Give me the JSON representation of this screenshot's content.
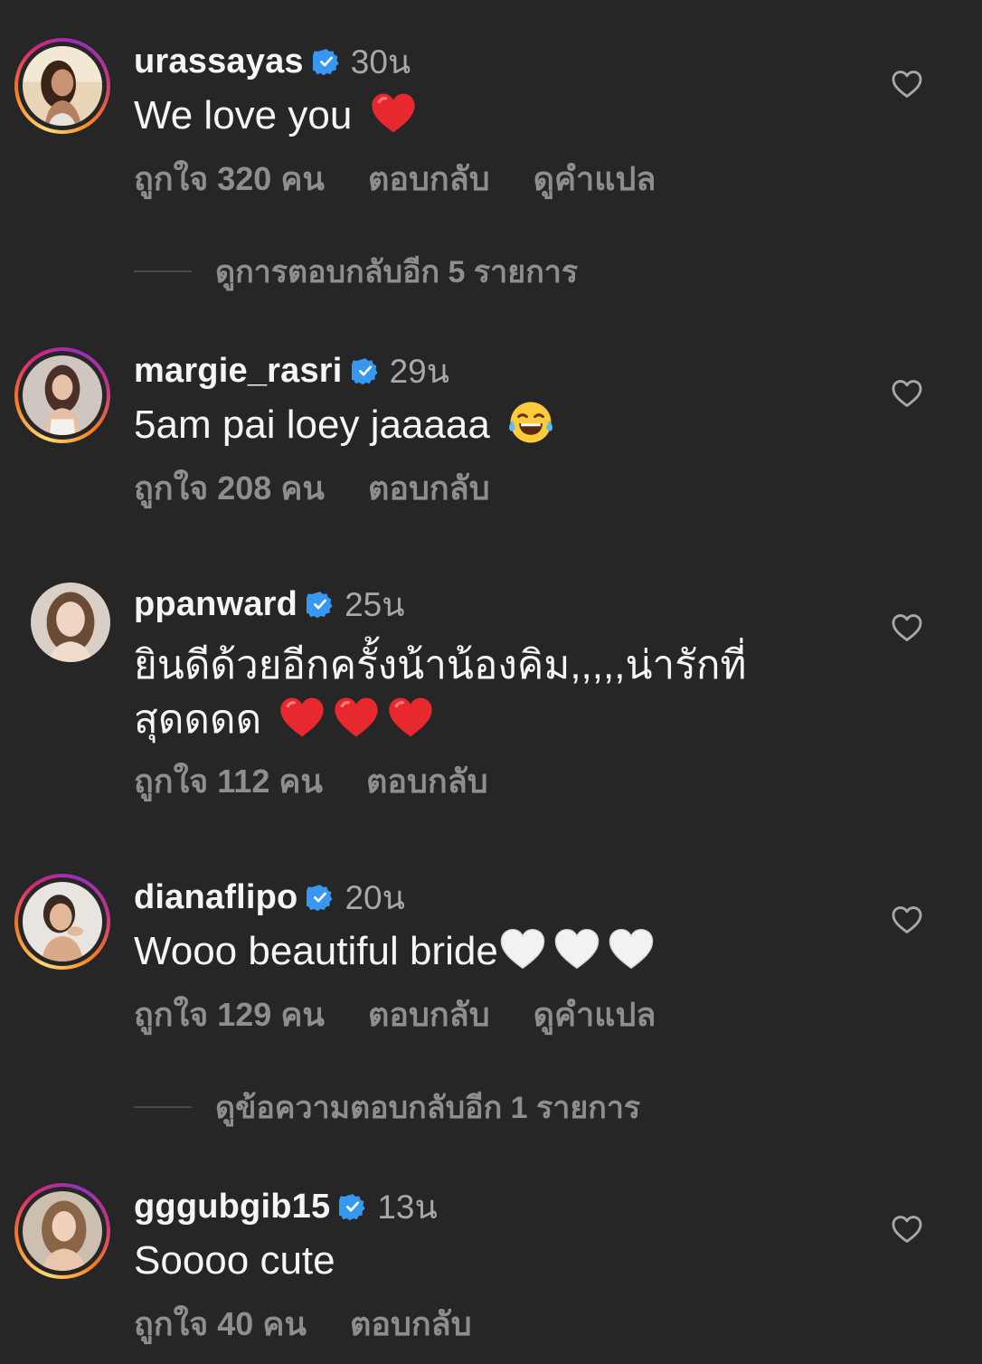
{
  "colors": {
    "background": "#262626",
    "primary_text": "#f5f5f5",
    "secondary_text": "#a8a8a8",
    "action_text": "#8e8e8e",
    "verified_badge": "#3897f0",
    "story_ring": [
      "#feda75",
      "#fa7e1e",
      "#d62976",
      "#962fbf"
    ]
  },
  "comments": [
    {
      "username": "urassayas",
      "verified": true,
      "time": "30น",
      "text": "We love you",
      "emojis": [
        "red-heart"
      ],
      "likes_label": "ถูกใจ 320 คน",
      "reply_label": "ตอบกลับ",
      "translate_label": "ดูคำแปล",
      "more_replies_label": "ดูการตอบกลับอีก 5 รายการ",
      "avatar_ring": true
    },
    {
      "username": "margie_rasri",
      "verified": true,
      "time": "29น",
      "text": "5am pai loey jaaaaa",
      "emojis": [
        "face-with-tears-of-joy"
      ],
      "likes_label": "ถูกใจ 208 คน",
      "reply_label": "ตอบกลับ",
      "avatar_ring": true
    },
    {
      "username": "ppanward",
      "verified": true,
      "time": "25น",
      "text": "ยินดีด้วยอีกครั้งน้าน้องคิม,,,,,น่ารักที่สุดดดด",
      "emojis": [
        "red-heart",
        "red-heart",
        "red-heart"
      ],
      "likes_label": "ถูกใจ 112 คน",
      "reply_label": "ตอบกลับ",
      "avatar_ring": false
    },
    {
      "username": "dianaflipo",
      "verified": true,
      "time": "20น",
      "text": "Wooo beautiful bride",
      "emojis": [
        "white-heart",
        "white-heart",
        "white-heart"
      ],
      "likes_label": "ถูกใจ 129 คน",
      "reply_label": "ตอบกลับ",
      "translate_label": "ดูคำแปล",
      "more_replies_label": "ดูข้อความตอบกลับอีก 1 รายการ",
      "avatar_ring": true
    },
    {
      "username": "gggubgib15",
      "verified": true,
      "time": "13น",
      "text": "Soooo cute",
      "emojis": [],
      "likes_label": "ถูกใจ 40 คน",
      "reply_label": "ตอบกลับ",
      "avatar_ring": true
    }
  ]
}
